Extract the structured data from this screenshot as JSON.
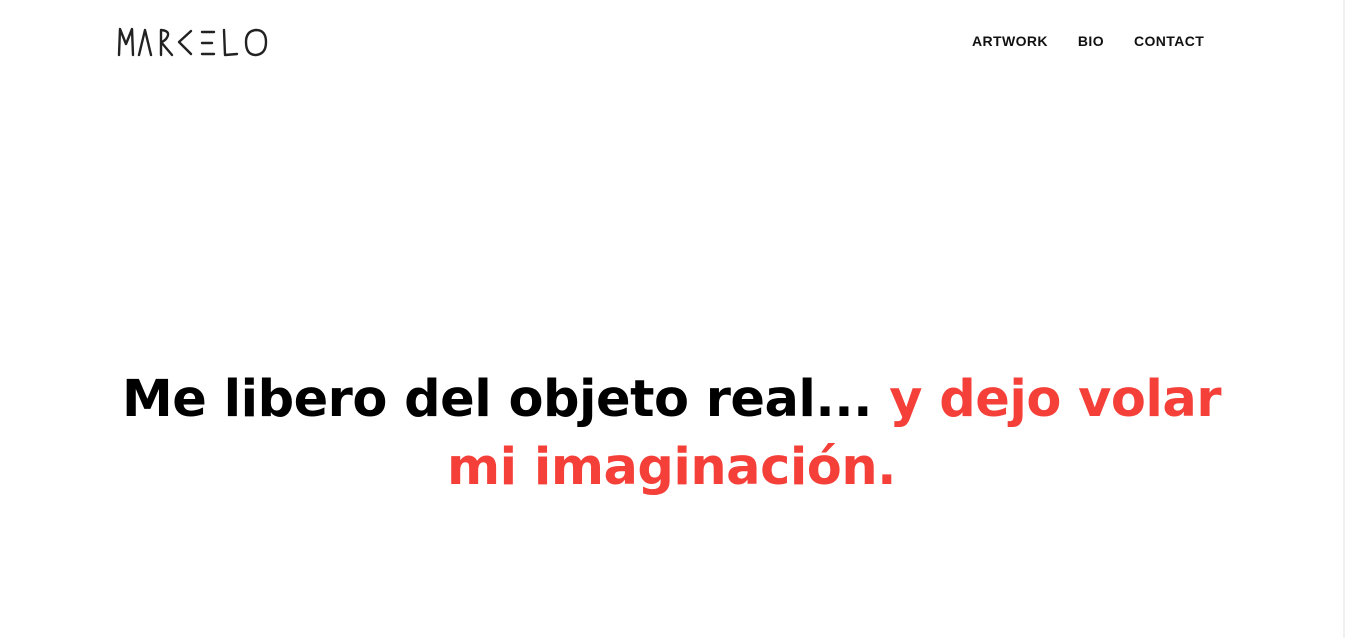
{
  "brand": {
    "logo_text": "MARCELO",
    "logo_icon": "marcelo-handwritten-logo"
  },
  "nav": {
    "items": [
      {
        "label": "ARTWORK"
      },
      {
        "label": "BIO"
      },
      {
        "label": "CONTACT"
      }
    ]
  },
  "hero": {
    "headline_black": "Me libero del objeto real...",
    "headline_accent": "y dejo volar mi imaginación."
  },
  "colors": {
    "background": "#ffffff",
    "text": "#000000",
    "accent": "#f5403a",
    "nav_text": "#111111"
  }
}
